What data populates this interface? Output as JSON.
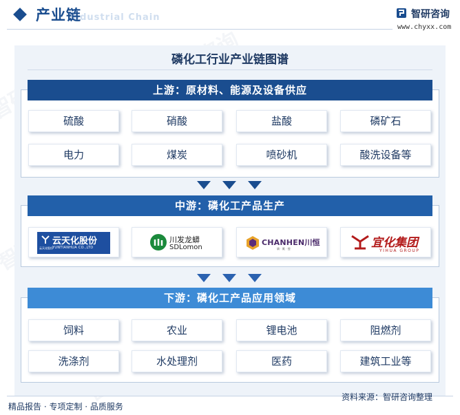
{
  "header": {
    "title": "产业链",
    "subtitle": "Industrial Chain",
    "brand_name": "智研咨询",
    "brand_url": "www.chyxx.com"
  },
  "diagram": {
    "title": "磷化工行业产业链图谱",
    "upstream": {
      "heading": "上游：原材料、能源及设备供应",
      "items": [
        "硫酸",
        "硝酸",
        "盐酸",
        "磷矿石",
        "电力",
        "煤炭",
        "喷砂机",
        "酸洗设备等"
      ]
    },
    "midstream": {
      "heading": "中游：磷化工产品生产",
      "companies": [
        {
          "name": "云天化股份",
          "en": "YUNTIANHUA CO.,LTD",
          "tiny": "云天化股份"
        },
        {
          "name": "川发龙蟒",
          "en": "SDLomon"
        },
        {
          "name": "CHANHEN川恒",
          "sub": "磷 · 氟 · 锂"
        },
        {
          "name": "宜化集团",
          "en": "YIHUA GROUP"
        }
      ]
    },
    "downstream": {
      "heading": "下游：磷化工产品应用领域",
      "items": [
        "饲料",
        "农业",
        "锂电池",
        "阻燃剂",
        "洗涤剂",
        "水处理剂",
        "医药",
        "建筑工业等"
      ]
    }
  },
  "footer": {
    "left": "精品报告 · 专项定制 · 品质服务",
    "source": "资料来源：智研咨询整理"
  },
  "colors": {
    "primary": "#1a4d8f",
    "mid_bar": "#2260aa",
    "light_bar": "#3d8bd6",
    "frame_bg": "#eef3f9"
  },
  "icons": [
    "diamond-icon",
    "brand-logo-icon",
    "arrow-down-icon"
  ]
}
